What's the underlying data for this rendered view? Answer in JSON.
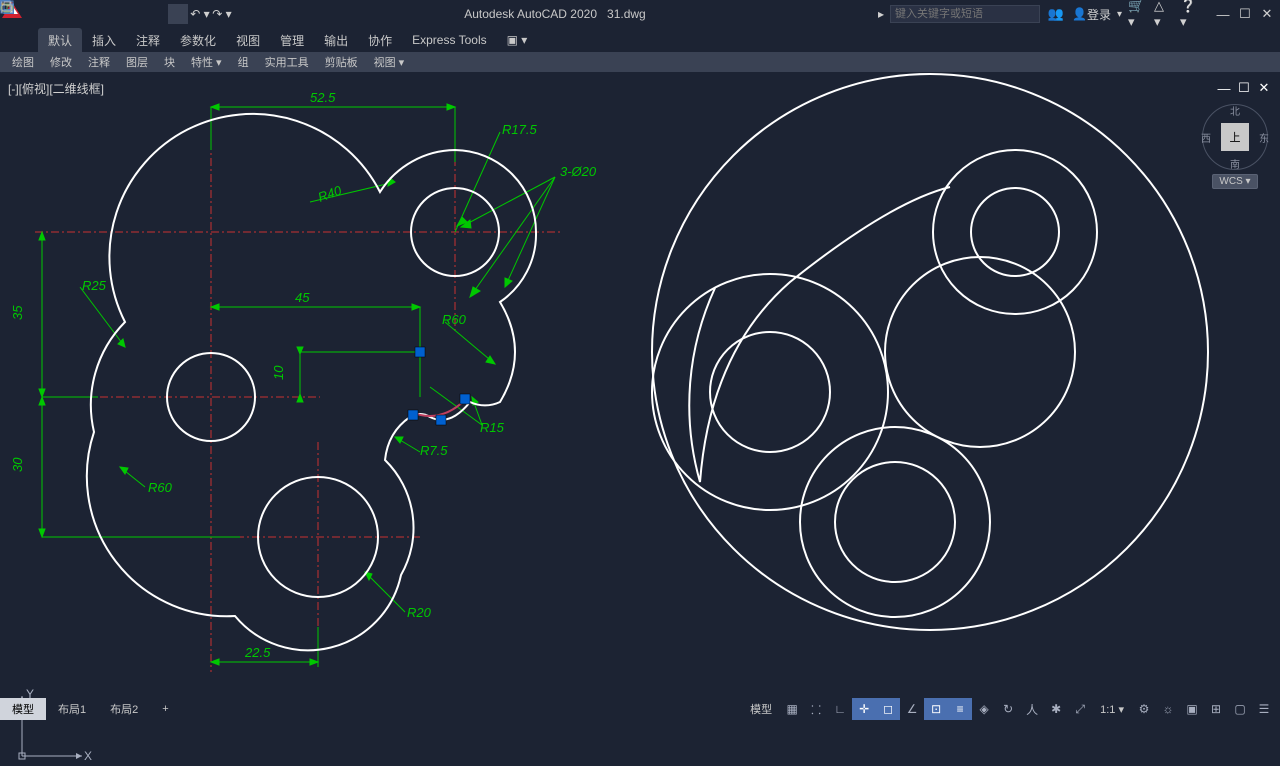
{
  "app": {
    "name": "Autodesk AutoCAD 2020",
    "file": "31.dwg"
  },
  "search": {
    "placeholder": "键入关键字或短语"
  },
  "login": {
    "label": "登录"
  },
  "ribbon_tabs": [
    "默认",
    "插入",
    "注释",
    "参数化",
    "视图",
    "管理",
    "输出",
    "协作",
    "Express Tools"
  ],
  "ribbon_panels": [
    "绘图",
    "修改",
    "注释",
    "图层",
    "块",
    "特性 ▾",
    "组",
    "实用工具",
    "剪贴板",
    "视图 ▾"
  ],
  "viewport_label": "[-][俯视][二维线框]",
  "viewcube": {
    "top": "上",
    "n": "北",
    "s": "南",
    "e": "东",
    "w": "西",
    "wcs": "WCS ▾"
  },
  "ucs": {
    "x": "X",
    "y": "Y"
  },
  "layout_tabs": [
    "模型",
    "布局1",
    "布局2"
  ],
  "status_model": "模型",
  "dimensions": {
    "d52_5": "52.5",
    "r17_5": "R17.5",
    "r40": "R40",
    "h3_20": "3-Ø20",
    "r25": "R25",
    "d45": "45",
    "r60a": "R60",
    "d10": "10",
    "r15": "R15",
    "r7_5": "R7.5",
    "d35": "35",
    "d30": "30",
    "r60b": "R60",
    "r20": "R20",
    "d22_5": "22.5"
  }
}
